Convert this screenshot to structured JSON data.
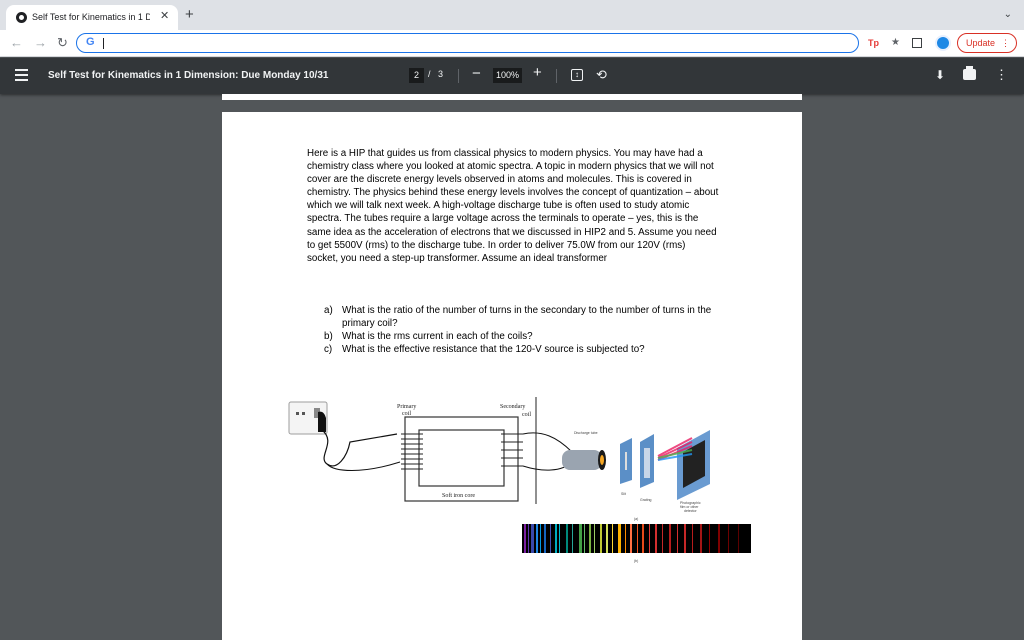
{
  "browser": {
    "tab_title": "Self Test for Kinematics in 1 Di",
    "tab_close": "✕",
    "new_tab": "+",
    "tab_search": "⌄",
    "omnibox_icon": "G",
    "update_label": "Update",
    "update_menu": "⋮",
    "ext_tp_label": "Tp",
    "icons": [
      "back-icon",
      "forward-icon",
      "reload-icon",
      "google-icon",
      "extension-tp-icon",
      "puzzle-icon",
      "window-icon",
      "profile-icon"
    ]
  },
  "pdf_toolbar": {
    "title": "Self Test for Kinematics in 1 Dimension: Due Monday 10/31",
    "page_current": "2",
    "page_sep": "/",
    "page_total": "3",
    "zoom_out": "−",
    "zoom": "100%",
    "zoom_in": "+",
    "icons": [
      "menu-icon",
      "fit-page-icon",
      "rotate-icon",
      "download-icon",
      "print-icon",
      "more-icon"
    ]
  },
  "document": {
    "paragraph": "Here is a HIP that guides us from classical physics to modern physics.  You may have had a chemistry class where you looked at atomic spectra. A topic in modern physics that we will not cover are the discrete energy levels observed in atoms and molecules.  This is covered in chemistry.  The physics behind these energy levels involves the concept of quantization – about which we will talk next week.  A high-voltage discharge tube is often used to study atomic spectra. The tubes require a large voltage across the terminals to operate – yes, this is the same idea as the acceleration of electrons that we discussed in HIP2 and 5.  Assume you need to get 5500V (rms) to the discharge tube.  In order to deliver 75.0W from our 120V (rms) socket, you need a step-up transformer.  Assume an ideal transformer",
    "questions": [
      {
        "label": "a)",
        "text": "What is the ratio of the number of turns in the secondary to the number of turns in the primary coil?"
      },
      {
        "label": "b)",
        "text": "What is the rms current in each of the coils?"
      },
      {
        "label": "c)",
        "text": "What is the effective resistance that the 120-V source is subjected to?"
      }
    ],
    "figure": {
      "primary_label": "Primary coil",
      "primary_l1": "Primary",
      "primary_l2": "coil",
      "secondary_l1": "Secondary",
      "secondary_l2": "coil",
      "core_label": "Soft iron core",
      "discharge_label": "Discharge tube",
      "slit_label": "Slit",
      "grating_label": "Grating",
      "film_l1": "Photographic",
      "film_l2": "film or other",
      "film_l3": "detector",
      "spectrum_top_label": "(a)",
      "spectrum_bottom_label": "(b)"
    }
  }
}
